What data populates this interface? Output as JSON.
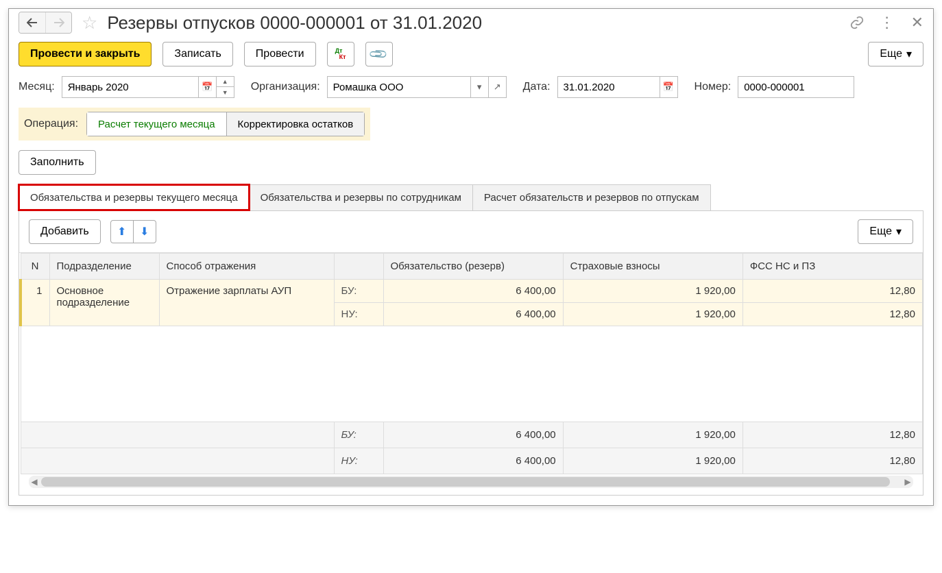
{
  "title": "Резервы отпусков 0000-000001 от 31.01.2020",
  "toolbar": {
    "post_and_close": "Провести и закрыть",
    "record": "Записать",
    "post": "Провести",
    "more": "Еще"
  },
  "fields": {
    "month_label": "Месяц:",
    "month_value": "Январь 2020",
    "org_label": "Организация:",
    "org_value": "Ромашка ООО",
    "date_label": "Дата:",
    "date_value": "31.01.2020",
    "number_label": "Номер:",
    "number_value": "0000-000001"
  },
  "operation": {
    "label": "Операция:",
    "opt1": "Расчет текущего месяца",
    "opt2": "Корректировка остатков"
  },
  "fill_button": "Заполнить",
  "tabs": {
    "t1": "Обязательства и резервы текущего месяца",
    "t2": "Обязательства и резервы по сотрудникам",
    "t3": "Расчет обязательств и резервов по отпускам"
  },
  "subbar": {
    "add": "Добавить",
    "more": "Еще"
  },
  "columns": {
    "n": "N",
    "dept": "Подразделение",
    "method": "Способ отражения",
    "liability": "Обязательство (резерв)",
    "insurance": "Страховые взносы",
    "fss": "ФСС НС и ПЗ"
  },
  "row_types": {
    "bu": "БУ:",
    "nu": "НУ:"
  },
  "rows": [
    {
      "n": "1",
      "dept": "Основное подразделение",
      "method": "Отражение зарплаты АУП",
      "bu": {
        "liability": "6 400,00",
        "insurance": "1 920,00",
        "fss": "12,80"
      },
      "nu": {
        "liability": "6 400,00",
        "insurance": "1 920,00",
        "fss": "12,80"
      }
    }
  ],
  "totals": {
    "bu": {
      "liability": "6 400,00",
      "insurance": "1 920,00",
      "fss": "12,80"
    },
    "nu": {
      "liability": "6 400,00",
      "insurance": "1 920,00",
      "fss": "12,80"
    }
  }
}
